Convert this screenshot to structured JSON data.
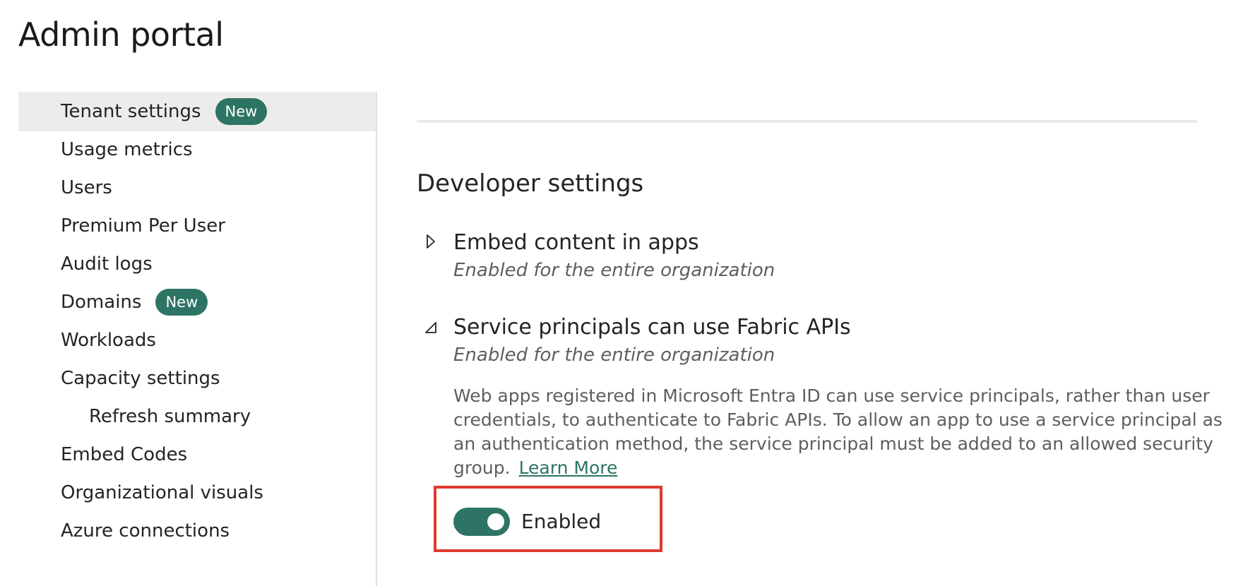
{
  "page": {
    "title": "Admin portal"
  },
  "sidebar": {
    "items": [
      {
        "label": "Tenant settings",
        "badge": "New",
        "active": true
      },
      {
        "label": "Usage metrics"
      },
      {
        "label": "Users"
      },
      {
        "label": "Premium Per User"
      },
      {
        "label": "Audit logs"
      },
      {
        "label": "Domains",
        "badge": "New"
      },
      {
        "label": "Workloads"
      },
      {
        "label": "Capacity settings"
      },
      {
        "label": "Refresh summary",
        "sub": true
      },
      {
        "label": "Embed Codes"
      },
      {
        "label": "Organizational visuals"
      },
      {
        "label": "Azure connections"
      }
    ]
  },
  "main": {
    "section_title": "Developer settings",
    "settings": [
      {
        "title": "Embed content in apps",
        "status": "Enabled for the entire organization",
        "expanded": false
      },
      {
        "title": "Service principals can use Fabric APIs",
        "status": "Enabled for the entire organization",
        "expanded": true,
        "description": "Web apps registered in Microsoft Entra ID can use service principals, rather than user credentials, to authenticate to Fabric APIs. To allow an app to use a service principal as an authentication method, the service principal must be added to an allowed security group.",
        "learn_more": "Learn More",
        "toggle_label": "Enabled",
        "toggle_on": true
      }
    ]
  },
  "colors": {
    "accent": "#2d7465",
    "highlight": "#e03b30",
    "active_bg": "#ececec"
  },
  "icons": {
    "collapsed": "chevron-right-icon",
    "expanded": "chevron-down-icon"
  }
}
